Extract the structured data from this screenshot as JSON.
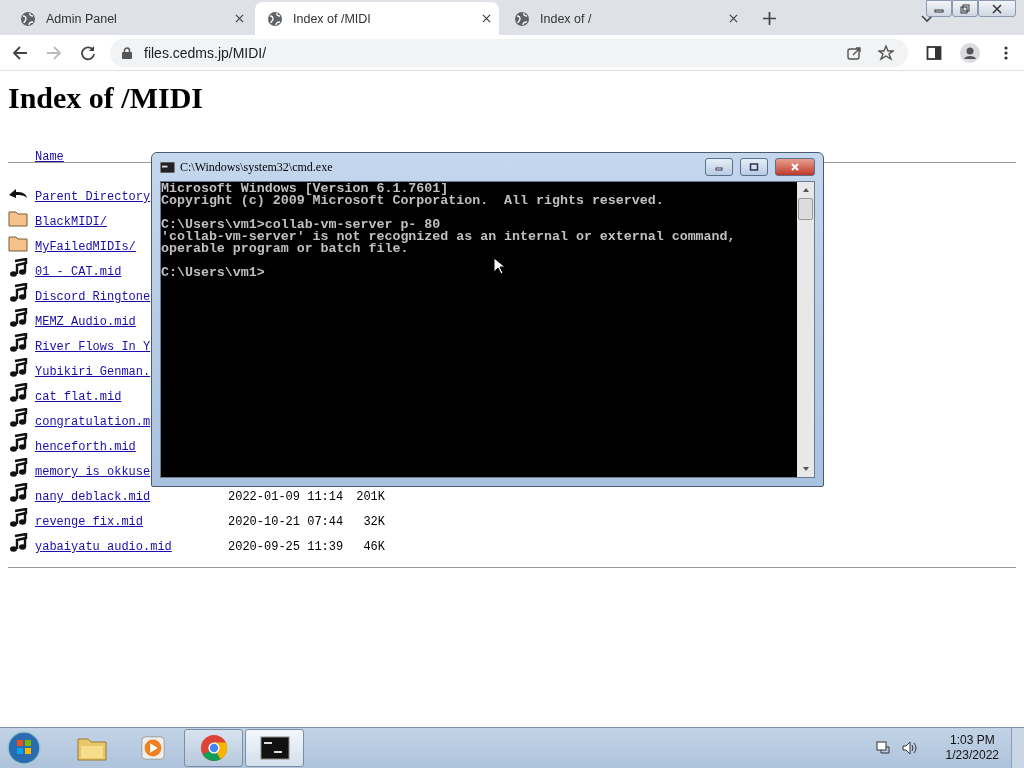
{
  "browser": {
    "tabs": [
      {
        "title": "Admin Panel",
        "selected": false
      },
      {
        "title": "Index of /MIDI",
        "selected": true
      },
      {
        "title": "Index of /",
        "selected": false
      }
    ],
    "url": "files.cedms.jp/MIDI/"
  },
  "page": {
    "heading": "Index of /MIDI",
    "name_column": "Name",
    "entries": [
      {
        "kind": "parent",
        "name": "Parent Directory"
      },
      {
        "kind": "folder",
        "name": "BlackMIDI/"
      },
      {
        "kind": "folder",
        "name": "MyFailedMIDIs/"
      },
      {
        "kind": "audio",
        "name": "01_-_CAT.mid"
      },
      {
        "kind": "audio",
        "name": "Discord Ringtone"
      },
      {
        "kind": "audio",
        "name": "MEMZ_Audio.mid"
      },
      {
        "kind": "audio",
        "name": "River Flows In Y"
      },
      {
        "kind": "audio",
        "name": "Yubikiri_Genman."
      },
      {
        "kind": "audio",
        "name": "cat_flat.mid"
      },
      {
        "kind": "audio",
        "name": "congratulation.m"
      },
      {
        "kind": "audio",
        "name": "henceforth.mid"
      },
      {
        "kind": "audio",
        "name": "memory_is_okkuse"
      },
      {
        "kind": "audio",
        "name": "nany_deblack.mid",
        "modified": "2022-01-09 11:14",
        "size": "201K"
      },
      {
        "kind": "audio",
        "name": "revenge_fix.mid",
        "modified": "2020-10-21 07:44",
        "size": "32K"
      },
      {
        "kind": "audio",
        "name": "yabaiyatu_audio.mid",
        "modified": "2020-09-25 11:39",
        "size": "46K"
      }
    ]
  },
  "console": {
    "title": "C:\\Windows\\system32\\cmd.exe",
    "blocks": [
      [
        "Microsoft Windows [Version 6.1.7601]",
        "Copyright (c) 2009 Microsoft Corporation.  All rights reserved."
      ],
      [
        "C:\\Users\\vm1>collab-vm-server p- 80",
        "'collab-vm-server' is not recognized as an internal or external command,",
        "operable program or batch file."
      ],
      [
        "C:\\Users\\vm1>"
      ]
    ]
  },
  "taskbar": {
    "apps": [
      {
        "kind": "explorer",
        "running": false,
        "selected": false
      },
      {
        "kind": "media",
        "running": false,
        "selected": false
      },
      {
        "kind": "chrome",
        "running": true,
        "selected": false
      },
      {
        "kind": "console",
        "running": true,
        "selected": true
      }
    ],
    "time": "1:03 PM",
    "date": "1/23/2022"
  }
}
